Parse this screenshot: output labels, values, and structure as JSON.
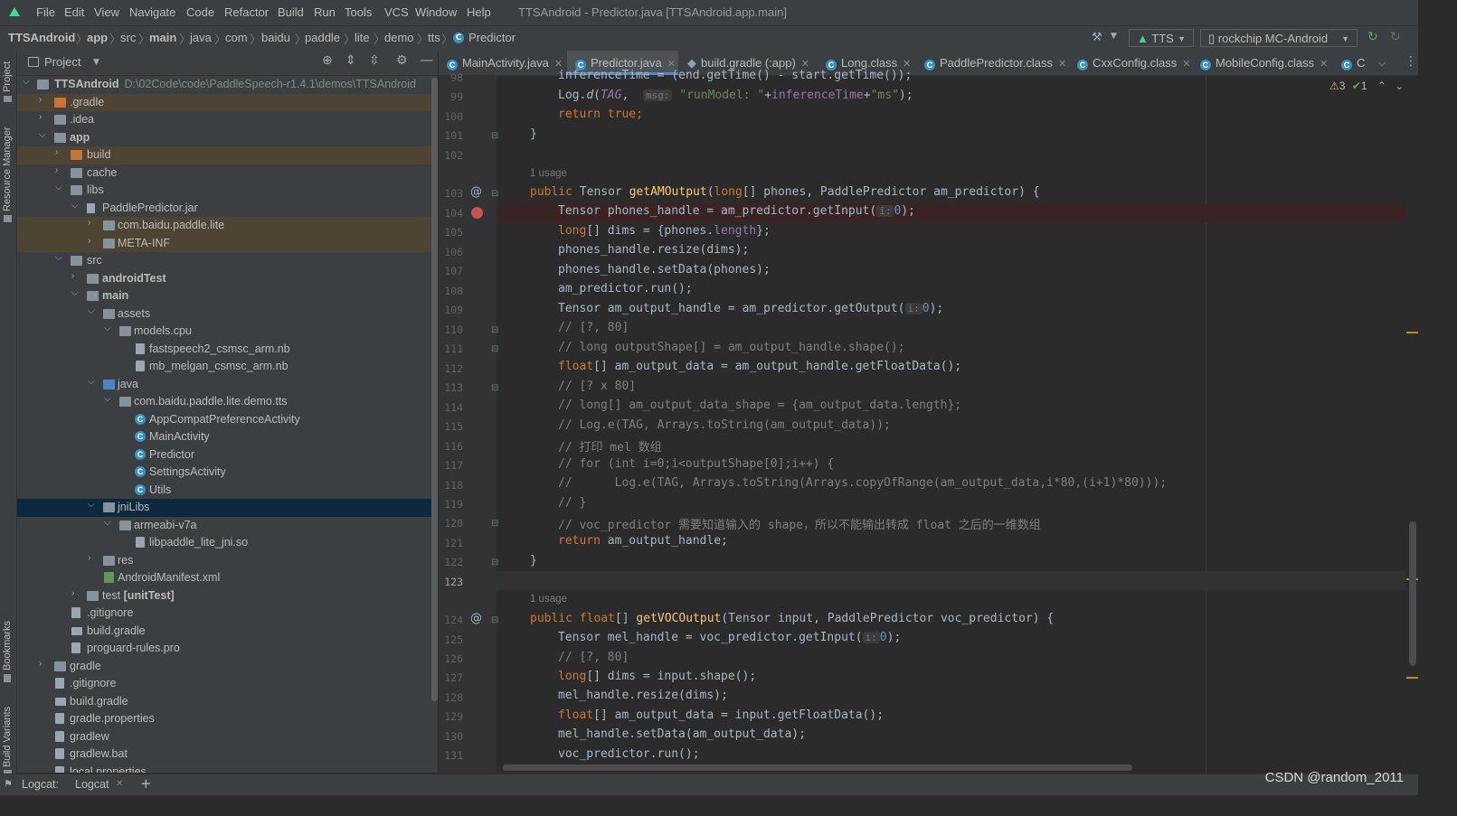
{
  "menu": {
    "items": [
      "File",
      "Edit",
      "View",
      "Navigate",
      "Code",
      "Refactor",
      "Build",
      "Run",
      "Tools",
      "VCS",
      "Window",
      "Help"
    ],
    "window_title": "TTSAndroid - Predictor.java [TTSAndroid.app.main]"
  },
  "breadcrumb": [
    "TTSAndroid",
    "app",
    "src",
    "main",
    "java",
    "com",
    "baidu",
    "paddle",
    "lite",
    "demo",
    "tts",
    "Predictor"
  ],
  "toolbar": {
    "run_config": "TTS",
    "device": "rockchip MC-Android"
  },
  "left_strip": {
    "project": "Project",
    "resource_manager": "Resource Manager",
    "bookmarks": "Bookmarks",
    "build_variants": "Build Variants"
  },
  "project_panel": {
    "title": "Project",
    "tree": [
      {
        "label": "TTSAndroid",
        "path": "D:\\02Code\\code\\PaddleSpeech-r1.4.1\\demos\\TTSAndroid",
        "bold": true
      },
      {
        "label": ".gradle"
      },
      {
        "label": ".idea"
      },
      {
        "label": "app",
        "bold": true
      },
      {
        "label": "build"
      },
      {
        "label": "cache"
      },
      {
        "label": "libs"
      },
      {
        "label": "PaddlePredictor.jar"
      },
      {
        "label": "com.baidu.paddle.lite"
      },
      {
        "label": "META-INF"
      },
      {
        "label": "src"
      },
      {
        "label": "androidTest",
        "bold": true
      },
      {
        "label": "main",
        "bold": true
      },
      {
        "label": "assets"
      },
      {
        "label": "models.cpu"
      },
      {
        "label": "fastspeech2_csmsc_arm.nb"
      },
      {
        "label": "mb_melgan_csmsc_arm.nb"
      },
      {
        "label": "java"
      },
      {
        "label": "com.baidu.paddle.lite.demo.tts"
      },
      {
        "label": "AppCompatPreferenceActivity"
      },
      {
        "label": "MainActivity"
      },
      {
        "label": "Predictor"
      },
      {
        "label": "SettingsActivity"
      },
      {
        "label": "Utils"
      },
      {
        "label": "jniLibs"
      },
      {
        "label": "armeabi-v7a"
      },
      {
        "label": "libpaddle_lite_jni.so"
      },
      {
        "label": "res"
      },
      {
        "label": "AndroidManifest.xml"
      },
      {
        "label": "test",
        "suffix": "[unitTest]"
      },
      {
        "label": ".gitignore"
      },
      {
        "label": "build.gradle"
      },
      {
        "label": "proguard-rules.pro"
      },
      {
        "label": "gradle"
      },
      {
        "label": ".gitignore"
      },
      {
        "label": "build.gradle"
      },
      {
        "label": "gradle.properties"
      },
      {
        "label": "gradlew"
      },
      {
        "label": "gradlew.bat"
      },
      {
        "label": "local.properties"
      }
    ]
  },
  "tabs": [
    "MainActivity.java",
    "Predictor.java",
    "build.gradle (:app)",
    "Long.class",
    "PaddlePredictor.class",
    "CxxConfig.class",
    "MobileConfig.class",
    "C"
  ],
  "inspections": {
    "warnings": "3",
    "ok": "1"
  },
  "line_numbers": [
    "98",
    "99",
    "100",
    "101",
    "102",
    "103",
    "104",
    "105",
    "106",
    "107",
    "108",
    "109",
    "110",
    "111",
    "112",
    "113",
    "114",
    "115",
    "116",
    "117",
    "118",
    "119",
    "120",
    "121",
    "122",
    "123",
    "124",
    "125",
    "126",
    "127",
    "128",
    "129",
    "130",
    "131"
  ],
  "usage_label": "1 usage",
  "code": {
    "l98": "inferenceTime = (end.getTime() - start.getTime());",
    "l99_a": "Log.",
    "l99_d": "d",
    "l99_tag": "TAG",
    "l99_msg": "msg:",
    "l99_str1": "\"runModel: \"",
    "l99_plus1": "+",
    "l99_field": "inferenceTime",
    "l99_plus2": "+",
    "l99_str2": "\"ms\"",
    "l99_end": ");",
    "l100_kw": "return true",
    "l101": "}",
    "l103_kw1": "public",
    "l103_type": " Tensor ",
    "l103_fn": "getAMOutput",
    "l103_params_a": "(",
    "l103_kw2": "long",
    "l103_params_b": "[] phones, PaddlePredictor am_predictor) {",
    "l104": "Tensor phones_handle = am_predictor.getInput(",
    "l104_hint": "i:",
    "l104_num": "0",
    "l104_end": ");",
    "l105_kw": "long",
    "l105_a": "[] dims = {phones.",
    "l105_fld": "length",
    "l105_b": "};",
    "l106": "phones_handle.resize(dims);",
    "l107": "phones_handle.setData(phones);",
    "l108": "am_predictor.run();",
    "l109": "Tensor am_output_handle = am_predictor.getOutput(",
    "l109_hint": "i:",
    "l109_num": "0",
    "l109_end": ");",
    "l110": "// [?, 80]",
    "l111": "// long outputShape[] = am_output_handle.shape();",
    "l112_kw": "float",
    "l112_a": "[] am_output_data = am_output_handle.getFloatData();",
    "l113": "// [? x 80]",
    "l114": "// long[] am_output_data_shape = {am_output_data.length};",
    "l115": "// Log.e(TAG, Arrays.toString(am_output_data));",
    "l116": "// 打印 mel 数组",
    "l117": "// for (int i=0;i<outputShape[0];i++) {",
    "l118": "//      Log.e(TAG, Arrays.toString(Arrays.copyOfRange(am_output_data,i*80,(i+1)*80)));",
    "l119": "// }",
    "l120": "// voc_predictor 需要知道输入的 shape，所以不能输出转成 float 之后的一维数组",
    "l121_kw": "return",
    "l121_a": " am_output_handle;",
    "l122": "}",
    "l124_kw1": "public",
    "l124_kw2": " float",
    "l124_a": "[] ",
    "l124_fn": "getVOCOutput",
    "l124_b": "(Tensor input, PaddlePredictor voc_predictor) {",
    "l125": "Tensor mel_handle = voc_predictor.getInput(",
    "l125_hint": "i:",
    "l125_num": "0",
    "l125_end": ");",
    "l126": "// [?, 80]",
    "l127_kw": "long",
    "l127_a": "[] dims = input.shape();",
    "l128": "mel_handle.resize(dims);",
    "l129_kw": "float",
    "l129_a": "[] am_output_data = input.getFloatData();",
    "l130": "mel_handle.setData(am_output_data);",
    "l131": "voc_predictor.run();"
  },
  "bottom": {
    "logcat_label": "Logcat:",
    "logcat_tab": "Logcat"
  },
  "watermark": "CSDN @random_2011"
}
